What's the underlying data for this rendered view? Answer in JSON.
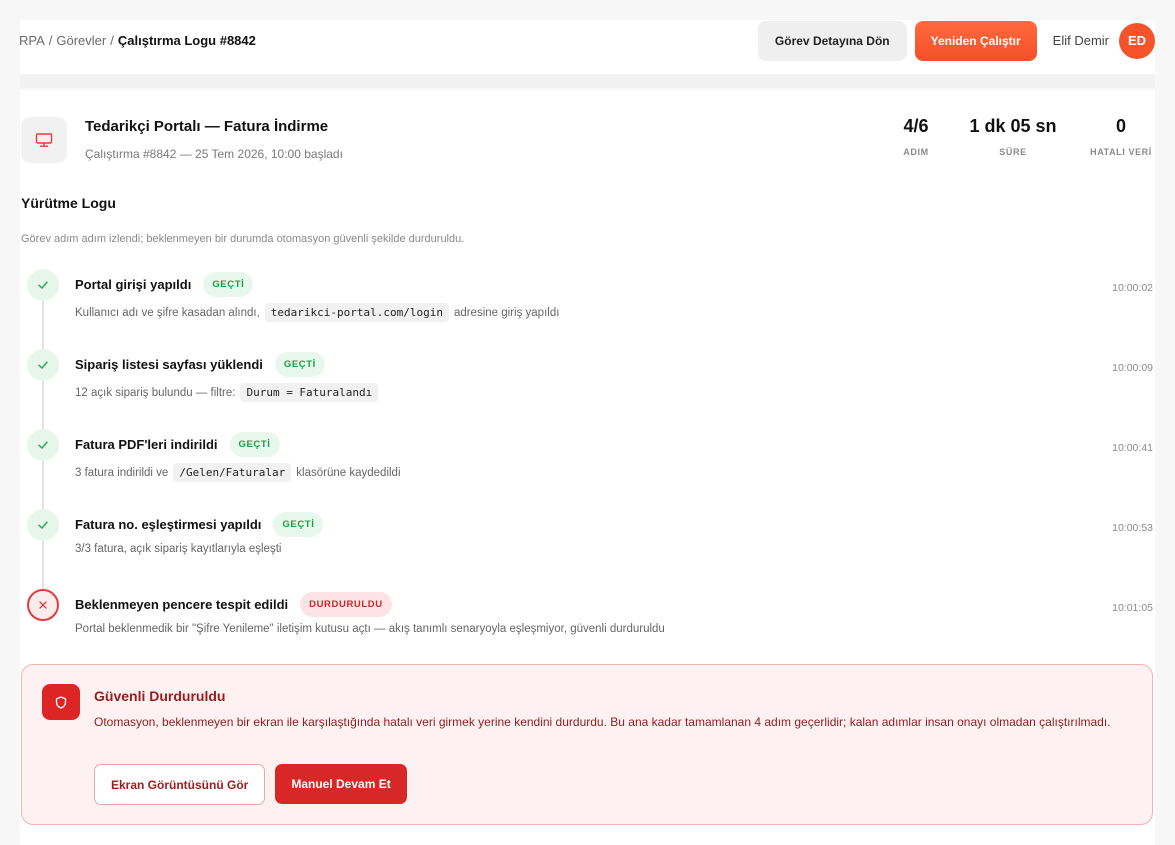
{
  "breadcrumb": {
    "root": "RPA",
    "sep1": "/",
    "tasks": "Görevler",
    "sep2": "/",
    "current": "Çalıştırma Logu #8842"
  },
  "header": {
    "back_button": "Görev Detayına Dön",
    "rerun_button": "Yeniden Çalıştır",
    "user_name": "Elif Demir",
    "avatar_initials": "ED"
  },
  "task": {
    "icon": "monitor-icon",
    "title": "Tedarikçi Portalı — Fatura İndirme",
    "subtitle": "Çalıştırma #8842 — 25 Tem 2026, 10:00 başladı"
  },
  "stats": [
    {
      "value": "4/6",
      "label": "ADIM"
    },
    {
      "value": "1 dk 05 sn",
      "label": "SÜRE"
    },
    {
      "value": "0",
      "label": "HATALI VERİ"
    }
  ],
  "log": {
    "title": "Yürütme Logu",
    "description": "Görev adım adım izlendi; beklenmeyen bir durumda otomasyon güvenli şekilde durduruldu."
  },
  "steps": [
    {
      "title": "Portal girişi yapıldı",
      "status": "GEÇTİ",
      "time": "10:00:02",
      "desc_before": "Kullanıcı adı ve şifre kasadan alındı,",
      "code": "tedarikci-portal.com/login",
      "desc_after": "adresine giriş yapıldı"
    },
    {
      "title": "Sipariş listesi sayfası yüklendi",
      "status": "GEÇTİ",
      "time": "10:00:09",
      "desc_before": "12 açık sipariş bulundu — filtre:",
      "code": "Durum = Faturalandı",
      "desc_after": ""
    },
    {
      "title": "Fatura PDF'leri indirildi",
      "status": "GEÇTİ",
      "time": "10:00:41",
      "desc_before": "3 fatura indirildi ve",
      "code": "/Gelen/Faturalar",
      "desc_after": "klasörüne kaydedildi"
    },
    {
      "title": "Fatura no. eşleştirmesi yapıldı",
      "status": "GEÇTİ",
      "time": "10:00:53",
      "desc_before": "3/3 fatura, açık sipariş kayıtlarıyla eşleşti",
      "code": "",
      "desc_after": ""
    },
    {
      "title": "Beklenmeyen pencere tespit edildi",
      "status": "DURDURULDU",
      "time": "10:01:05",
      "desc_before": "Portal beklenmedik bir \"Şifre Yenileme\" iletişim kutusu açtı — akış tanımlı senaryoyla eşleşmiyor, güvenli durduruldu",
      "code": "",
      "desc_after": ""
    }
  ],
  "alert": {
    "icon": "shield-icon",
    "title": "Güvenli Durduruldu",
    "text": "Otomasyon, beklenmeyen bir ekran ile karşılaştığında hatalı veri girmek yerine kendini durdurdu. Bu ana kadar tamamlanan 4 adım geçerlidir; kalan adımlar insan onayı olmadan çalıştırılmadı.",
    "screenshot_button": "Ekran Görüntüsünü Gör",
    "continue_button": "Manuel Devam Et"
  },
  "colors": {
    "accent": "#f4532b",
    "success": "#2eaa55",
    "danger": "#dc2626"
  }
}
